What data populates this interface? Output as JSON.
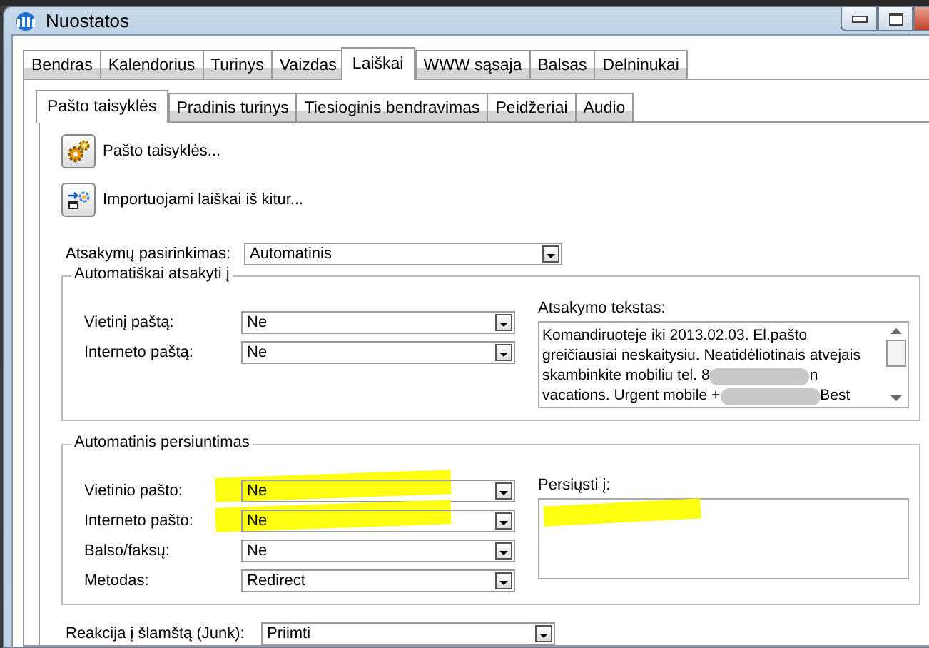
{
  "window": {
    "title": "Nuostatos"
  },
  "tabs": [
    {
      "label": "Bendras",
      "selected": false
    },
    {
      "label": "Kalendorius",
      "selected": false
    },
    {
      "label": "Turinys",
      "selected": false
    },
    {
      "label": "Vaizdas",
      "selected": false
    },
    {
      "label": "Laiškai",
      "selected": true
    },
    {
      "label": "WWW sąsaja",
      "selected": false
    },
    {
      "label": "Balsas",
      "selected": false
    },
    {
      "label": "Delninukai",
      "selected": false
    }
  ],
  "subtabs": [
    {
      "label": "Pašto taisyklės",
      "selected": true
    },
    {
      "label": "Pradinis turinys",
      "selected": false
    },
    {
      "label": "Tiesioginis bendravimas",
      "selected": false
    },
    {
      "label": "Peidžeriai",
      "selected": false
    },
    {
      "label": "Audio",
      "selected": false
    }
  ],
  "actions": [
    {
      "label": "Pašto taisyklės...",
      "kind": "gears"
    },
    {
      "label": "Importuojami laiškai iš kitur...",
      "kind": "import"
    }
  ],
  "reply_selection": {
    "label": "Atsakymų pasirinkimas:",
    "value": "Automatinis"
  },
  "auto_reply": {
    "title": "Automatiškai atsakyti į",
    "fields": [
      {
        "label": "Vietinį paštą:",
        "value": "Ne"
      },
      {
        "label": "Interneto paštą:",
        "value": "Ne"
      }
    ],
    "reply_text": {
      "label": "Atsakymo tekstas:",
      "lines": [
        [
          {
            "kind": "text",
            "text": "Komandiruoteje iki 2013.02.03. El.pašto"
          }
        ],
        [
          {
            "kind": "text",
            "text": "greičiausiai neskaitysiu. Neatidėliotinais atvejais"
          }
        ],
        [
          {
            "kind": "text",
            "text": "skambinkite mobiliu tel. 8"
          },
          {
            "kind": "redacted"
          },
          {
            "kind": "text",
            "text": "n"
          }
        ],
        [
          {
            "kind": "text",
            "text": "vacations. Urgent mobile +"
          },
          {
            "kind": "redacted"
          },
          {
            "kind": "text",
            "text": "Best"
          }
        ]
      ]
    }
  },
  "forwarding": {
    "title": "Automatinis persiuntimas",
    "fields": [
      {
        "label": "Vietinio pašto:",
        "value": "Ne",
        "highlighted": true
      },
      {
        "label": "Interneto pašto:",
        "value": "Ne",
        "highlighted": true
      },
      {
        "label": "Balso/faksų:",
        "value": "Ne",
        "highlighted": false
      },
      {
        "label": "Metodas:",
        "value": "Redirect",
        "highlighted": false
      }
    ],
    "forward_to": {
      "label": "Persiųsti į:",
      "highlighted": true
    }
  },
  "junk": {
    "label": "Reakcija į šlamštą (Junk):",
    "value": "Priimti"
  }
}
